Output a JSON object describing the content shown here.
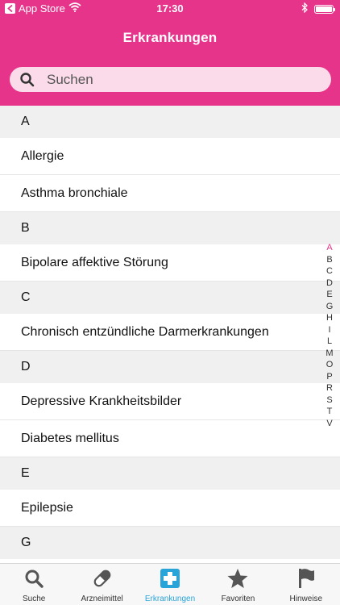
{
  "status_bar": {
    "carrier": "App Store",
    "time": "17:30"
  },
  "nav": {
    "title": "Erkrankungen"
  },
  "search": {
    "placeholder": "Suchen",
    "value": ""
  },
  "sections": [
    {
      "letter": "A",
      "items": [
        "Allergie",
        "Asthma bronchiale"
      ]
    },
    {
      "letter": "B",
      "items": [
        "Bipolare affektive Störung"
      ]
    },
    {
      "letter": "C",
      "items": [
        "Chronisch entzündliche Darmerkrankungen"
      ]
    },
    {
      "letter": "D",
      "items": [
        "Depressive Krankheitsbilder",
        "Diabetes mellitus"
      ]
    },
    {
      "letter": "E",
      "items": [
        "Epilepsie"
      ]
    },
    {
      "letter": "G",
      "items": []
    }
  ],
  "index_letters": [
    "A",
    "B",
    "C",
    "D",
    "E",
    "G",
    "H",
    "I",
    "L",
    "M",
    "O",
    "P",
    "R",
    "S",
    "T",
    "V"
  ],
  "index_active": "A",
  "tabs": [
    {
      "label": "Suche",
      "icon": "search-icon",
      "active": false
    },
    {
      "label": "Arzneimittel",
      "icon": "pill-icon",
      "active": false
    },
    {
      "label": "Erkrankungen",
      "icon": "medical-cross-icon",
      "active": true
    },
    {
      "label": "Favoriten",
      "icon": "star-icon",
      "active": false
    },
    {
      "label": "Hinweise",
      "icon": "flag-icon",
      "active": false
    }
  ],
  "colors": {
    "brand": "#e6348b",
    "search_bg": "#fbdbe9",
    "tab_active": "#29a4d8",
    "section_bg": "#f0f0f0"
  }
}
